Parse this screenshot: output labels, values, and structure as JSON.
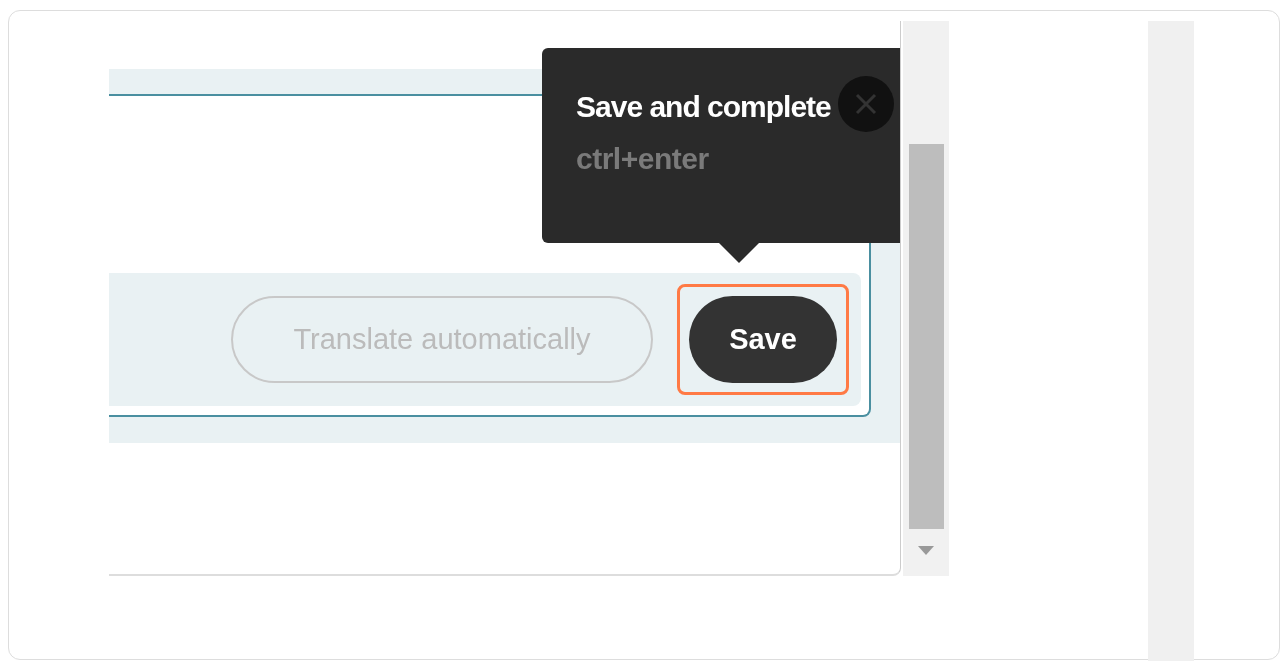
{
  "tooltip": {
    "title": "Save and complete",
    "shortcut": "ctrl+enter"
  },
  "buttons": [
    {
      "label": "Translate automatically",
      "kind": "secondary",
      "disabled": true,
      "highlighted": false
    },
    {
      "label": "Save",
      "kind": "primary",
      "disabled": false,
      "highlighted": true
    }
  ]
}
